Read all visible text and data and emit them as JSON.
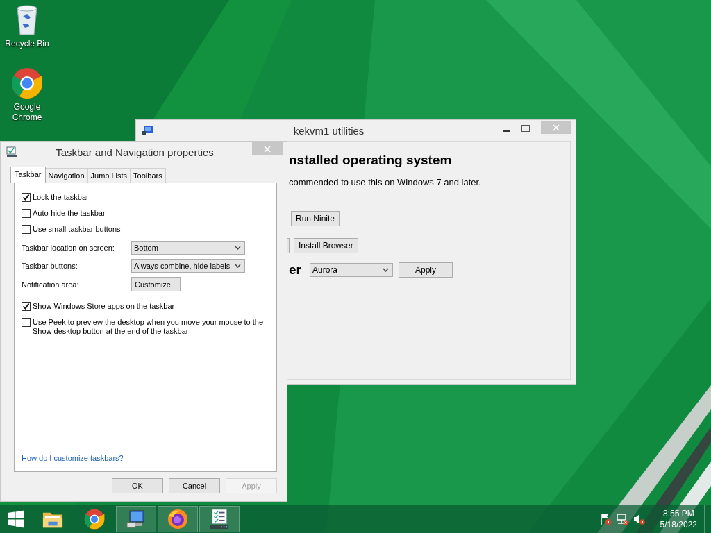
{
  "desktop_icons": [
    {
      "kind": "recycle-bin",
      "label": "Recycle Bin"
    },
    {
      "kind": "browser",
      "label": "Google Chrome"
    }
  ],
  "utilities_window": {
    "title": "kekvm1 utilities",
    "heading": "nstalled operating system",
    "note": "commended to use this on Windows 7 and later.",
    "rows": [
      {
        "kind": "buttons",
        "cut_button": false,
        "buttons": [
          "Run Ninite"
        ]
      },
      {
        "kind": "buttons",
        "cut_button": true,
        "buttons": [
          "Install Browser"
        ]
      },
      {
        "kind": "select",
        "label": "er",
        "value": "Aurora",
        "button": "Apply"
      }
    ]
  },
  "properties_dialog": {
    "title": "Taskbar and Navigation properties",
    "tabs": [
      {
        "label": "Taskbar",
        "selected": true
      },
      {
        "label": "Navigation",
        "selected": false
      },
      {
        "label": "Jump Lists",
        "selected": false
      },
      {
        "label": "Toolbars",
        "selected": false
      }
    ],
    "options_top": [
      {
        "label": "Lock the taskbar",
        "checked": true
      },
      {
        "label": "Auto-hide the taskbar",
        "checked": false
      },
      {
        "label": "Use small taskbar buttons",
        "checked": false
      }
    ],
    "settings": [
      {
        "label": "Taskbar location on screen:",
        "kind": "select",
        "value": "Bottom"
      },
      {
        "label": "Taskbar buttons:",
        "kind": "select",
        "value": "Always combine, hide labels"
      },
      {
        "label": "Notification area:",
        "kind": "button",
        "value": "Customize..."
      }
    ],
    "options_bottom": [
      {
        "label": "Show Windows Store apps on the taskbar",
        "checked": true
      },
      {
        "label": "Use Peek to preview the desktop when you move your mouse to the Show desktop button at the end of the taskbar",
        "checked": false
      }
    ],
    "help_link": "How do I customize taskbars?",
    "buttons": [
      {
        "label": "OK",
        "disabled": false
      },
      {
        "label": "Cancel",
        "disabled": false
      },
      {
        "label": "Apply",
        "disabled": true
      }
    ]
  },
  "taskbar": {
    "items": [
      {
        "kind": "folder",
        "active": false
      },
      {
        "kind": "browser",
        "active": false
      },
      {
        "kind": "computer",
        "active": true
      },
      {
        "kind": "firefox",
        "active": true
      },
      {
        "kind": "checklist",
        "active": true
      }
    ],
    "tray": [
      {
        "kind": "flag"
      },
      {
        "kind": "network"
      },
      {
        "kind": "speaker"
      }
    ],
    "time": "8:55 PM",
    "date": "5/18/2022"
  }
}
